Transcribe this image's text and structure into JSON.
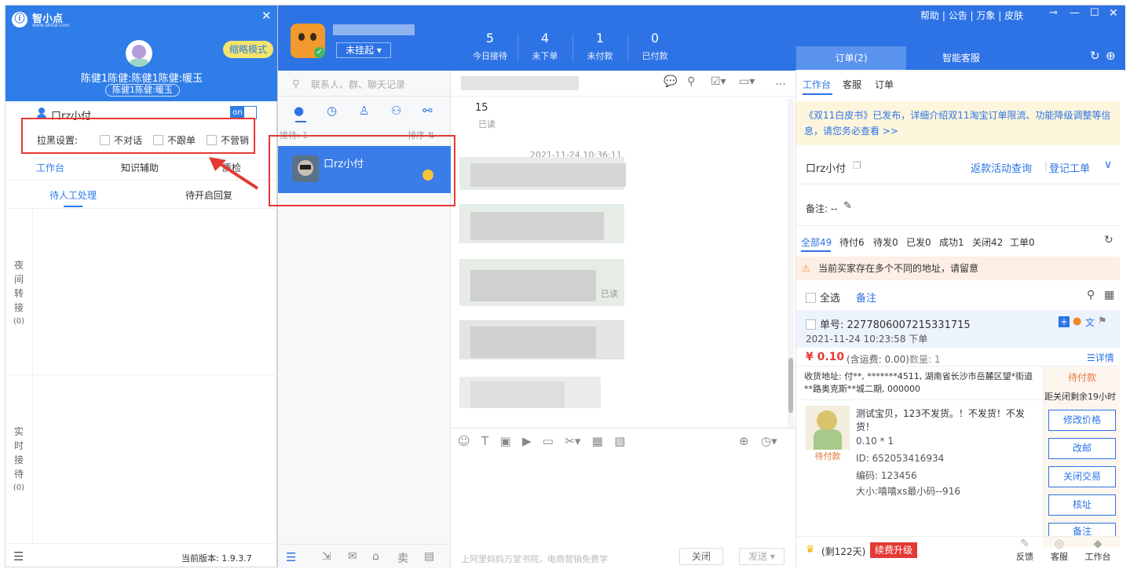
{
  "left_panel": {
    "brand": "智小点",
    "brand_url": "www.abital.com",
    "mode_button": "缩略模式",
    "user_line": "陈健1陈健:陈健1陈健:暖玉",
    "user_tag": "陈健1陈健:暖玉",
    "contact_name": "口rz小付",
    "toggle": "on",
    "blacklist_label": "拉黑设置:",
    "blacklist_options": [
      "不对话",
      "不跟单",
      "不营销"
    ],
    "tabs": [
      "工作台",
      "知识辅助",
      "质检"
    ],
    "subtabs": [
      "待人工处理",
      "待开启回复"
    ],
    "side_sections": [
      {
        "chars": [
          "夜",
          "间",
          "转",
          "接"
        ],
        "count": "(0)"
      },
      {
        "chars": [
          "实",
          "时",
          "接",
          "待"
        ],
        "count": "(0)"
      }
    ],
    "version": "当前版本: 1.9.3.7"
  },
  "top": {
    "status_select": "未挂起",
    "stats": [
      {
        "num": "5",
        "label": "今日接待"
      },
      {
        "num": "4",
        "label": "未下单"
      },
      {
        "num": "1",
        "label": "未付款"
      },
      {
        "num": "0",
        "label": "已付款"
      }
    ],
    "menu": [
      "帮助",
      "公告",
      "万象",
      "皮肤"
    ],
    "right_tabs": [
      "订单(2)",
      "智能客服"
    ]
  },
  "contacts": {
    "search_placeholder": "联系人、群、聊天记录",
    "receive_label": "接待: 1",
    "sort_label": "排序 ⇅",
    "selected_contact": "口rz小付"
  },
  "chat": {
    "msg_num": "15",
    "msg_read": "已读",
    "timestamp": "2021-11-24 10:36:11",
    "read1": "已读",
    "footer_text": "上阿里妈妈万堂书院，电商营销免费学",
    "close_btn": "关闭",
    "send_btn": "发送"
  },
  "right_panel": {
    "tabs": [
      "工作台",
      "客服",
      "订单"
    ],
    "notice": "《双11白皮书》已发布，详细介绍双11淘宝订单限流、功能降级调整等信息，请您务必查看 >>",
    "customer_name": "口rz小付",
    "links": [
      "返款活动查询",
      "登记工单"
    ],
    "remark_label": "备注: --",
    "order_tabs": [
      "全部49",
      "待付6",
      "待发0",
      "已发0",
      "成功1",
      "关闭42",
      "工单0"
    ],
    "warning": "当前买家存在多个不同的地址，请留意",
    "select_all": "全选",
    "remark_link": "备注",
    "order_no_label": "单号: ",
    "order_no": "2277806007215331715",
    "order_time": "2021-11-24 10:23:58 下单",
    "price": "¥ 0.10",
    "shipping": "(含运费: 0.00)",
    "quantity": "数量: 1",
    "detail_link": "详情",
    "address": "收货地址: 付**, *******4511, 湖南省长沙市岳麓区望*街道**路奥克斯**城二期, 000000",
    "status": "待付款",
    "countdown": "距关闭剩余19小时",
    "product_title": "测试宝贝，123不发货。！不发货！不发货！",
    "product_price": "0.10 * 1",
    "product_id": "ID: 652053416934",
    "product_code": "编码: 123456",
    "product_size": "大小:嘻嘻xs最小码--916",
    "product_badge": "待付款",
    "actions": [
      "修改价格",
      "改邮",
      "关闭交易",
      "核址",
      "备注"
    ],
    "bottom_days": "(剩122天)",
    "upgrade": "续费升级",
    "bottom_icons": [
      "反馈",
      "客服",
      "工作台"
    ]
  },
  "colors": {
    "primary": "#2d73e6",
    "red": "#e53935",
    "price": "#e53935"
  }
}
